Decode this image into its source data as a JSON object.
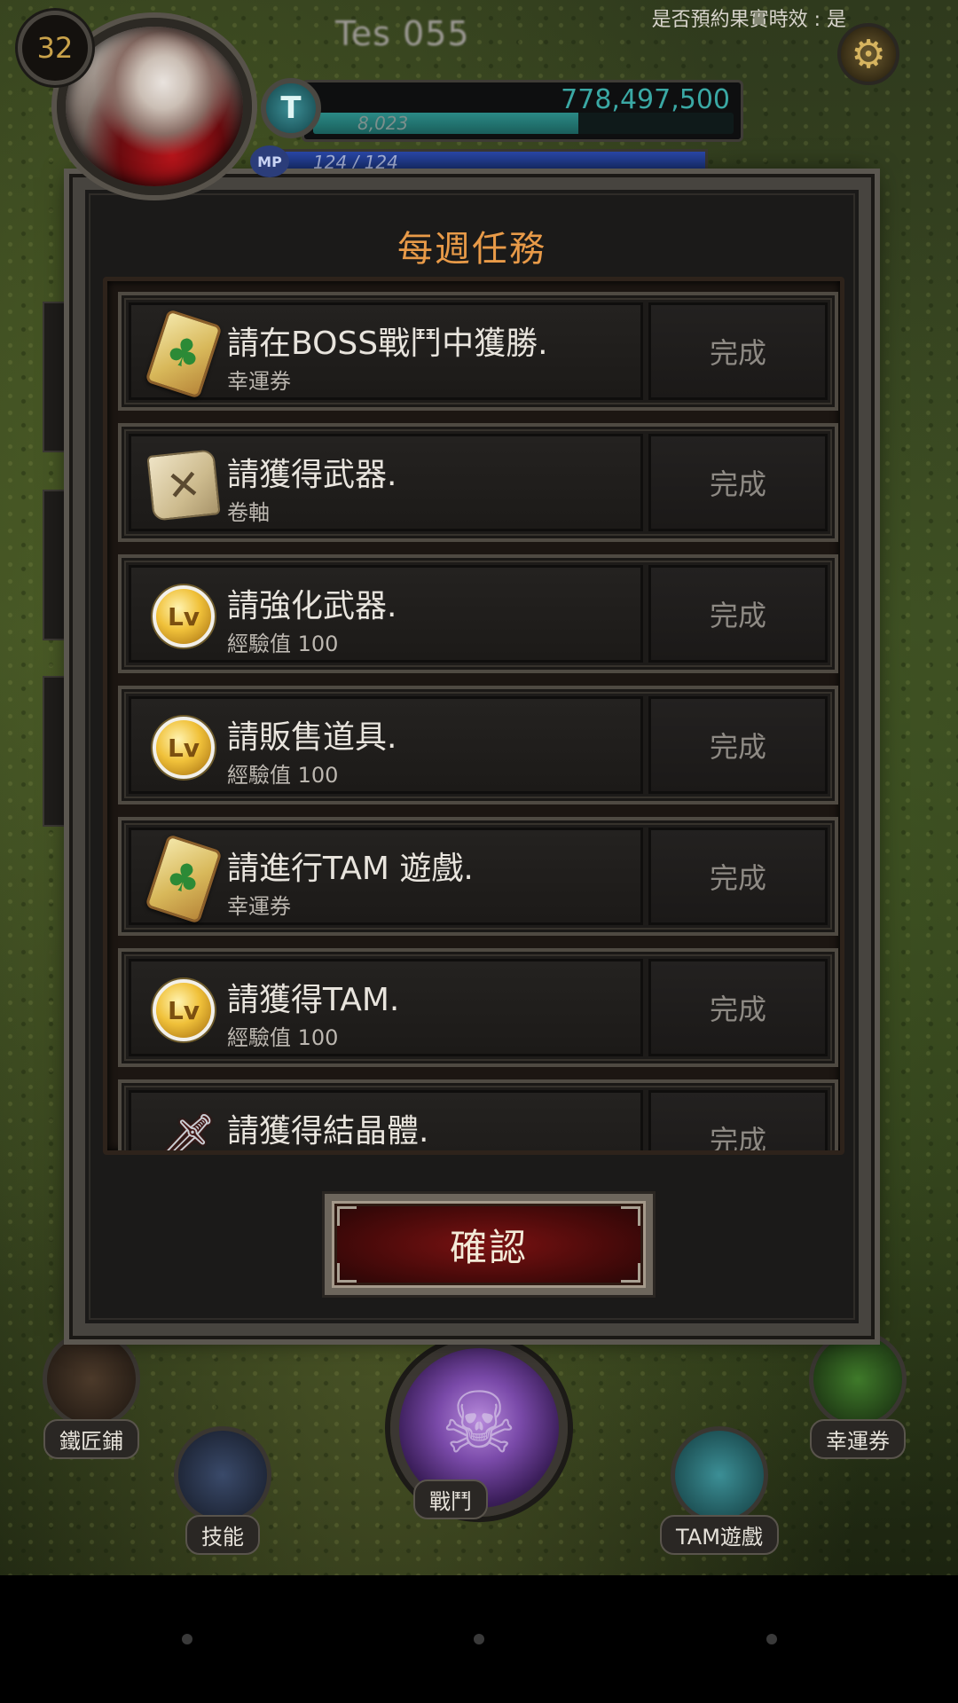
{
  "hud": {
    "level": "32",
    "player_name": "Tes 055",
    "reservation_status": "是否預約果實時效 : 是",
    "tam_amount": "778,497,500",
    "exp_value": "8,023",
    "exp_fraction": 0.63,
    "mp_label": "MP",
    "mp_value": "124 / 124"
  },
  "modal": {
    "title": "每週任務",
    "missions": [
      {
        "title": "請在BOSS戰鬥中獲勝.",
        "reward": "幸運券",
        "status": "完成",
        "icon": "lucky-ticket-icon"
      },
      {
        "title": "請獲得武器.",
        "reward": "卷軸",
        "status": "完成",
        "icon": "scroll-icon"
      },
      {
        "title": "請強化武器.",
        "reward": "經驗值 100",
        "status": "完成",
        "icon": "lv-coin-icon"
      },
      {
        "title": "請販售道具.",
        "reward": "經驗值 100",
        "status": "完成",
        "icon": "lv-coin-icon"
      },
      {
        "title": "請進行TAM 遊戲.",
        "reward": "幸運券",
        "status": "完成",
        "icon": "lucky-ticket-icon"
      },
      {
        "title": "請獲得TAM.",
        "reward": "經驗值 100",
        "status": "完成",
        "icon": "lv-coin-icon"
      },
      {
        "title": "請獲得結晶體.",
        "reward": "",
        "status": "完成",
        "icon": "sword-icon"
      }
    ],
    "confirm_label": "確認"
  },
  "bottom_nav": {
    "blacksmith": "鐵匠鋪",
    "skills": "技能",
    "battle": "戰鬥",
    "tam_game": "TAM遊戲",
    "lucky_ticket": "幸運券"
  },
  "colors": {
    "title_orange": "#e89a48",
    "tam_teal": "#3aa8a4",
    "confirm_red": "#7a1212"
  }
}
